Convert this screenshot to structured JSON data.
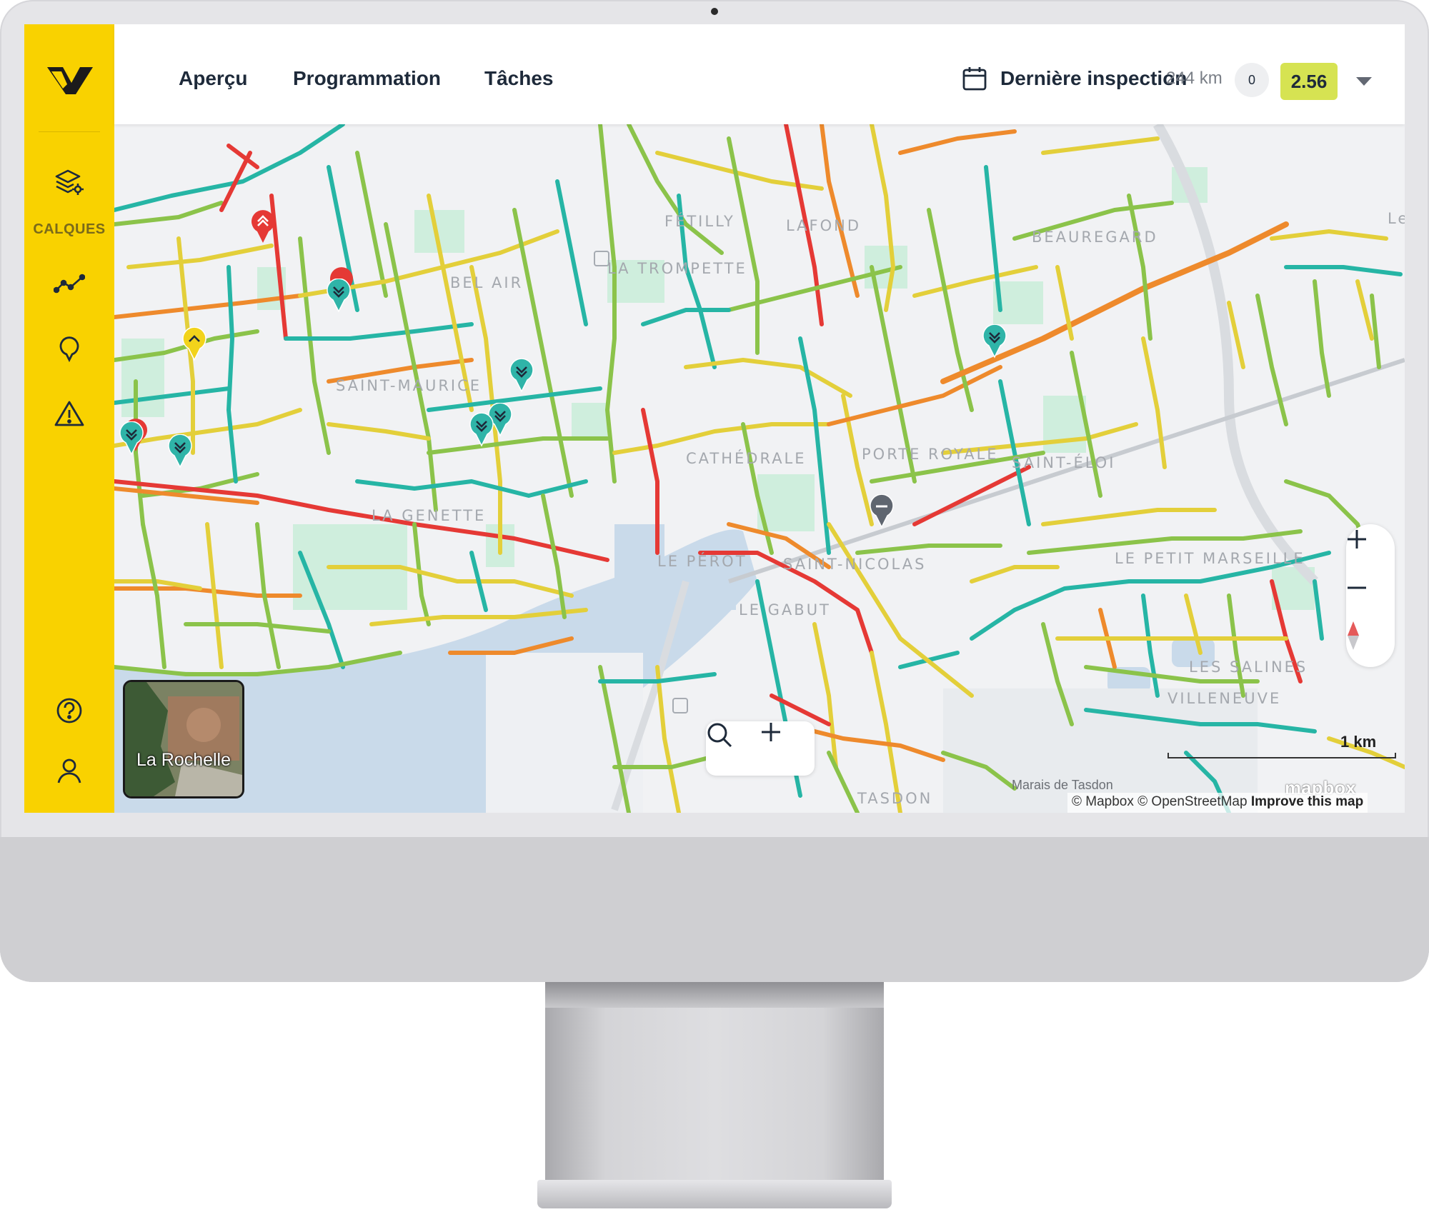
{
  "nav": {
    "tabs": [
      {
        "label": "Aperçu"
      },
      {
        "label": "Programmation"
      },
      {
        "label": "Tâches"
      }
    ]
  },
  "sidebar": {
    "layers_label": "CALQUES",
    "icons": [
      "layers-settings-icon",
      "chart-line-icon",
      "map-pin-icon",
      "warning-icon",
      "help-icon",
      "user-icon"
    ]
  },
  "inspection": {
    "label": "Dernière inspection",
    "distance": "244 km",
    "count": "0",
    "score": "2.56"
  },
  "map": {
    "districts": [
      "FÉTILLY",
      "LAFOND",
      "BEAUREGARD",
      "LA TROMPETTE",
      "BEL AIR",
      "SAINT-MAURICE",
      "CATHÉDRALE",
      "PORTE ROYALE",
      "SAINT-ÉLOI",
      "LA GENETTE",
      "LE PÉROT",
      "SAINT-NICOLAS",
      "LE GABUT",
      "LE PETIT MARSEILLE",
      "VILLENEUVE",
      "LES SALINES",
      "TASDON",
      "Le"
    ],
    "minimap_label": "La Rochelle",
    "scale": "1 km",
    "logo_text": "mapbox",
    "attribution_mapbox": "© Mapbox",
    "attribution_osm": "© OpenStreetMap",
    "attribution_improve": "Improve this map",
    "marais_label": "Marais de Tasdon",
    "colors": {
      "green": "#8bc34a",
      "teal": "#26b5a5",
      "yellow": "#e3cf3a",
      "orange": "#ee8a2c",
      "red": "#e53935",
      "water": "#c9daea",
      "park": "#cfeedd"
    }
  },
  "brand": {
    "accent": "#f9d200",
    "score_bg": "#d6e352"
  }
}
